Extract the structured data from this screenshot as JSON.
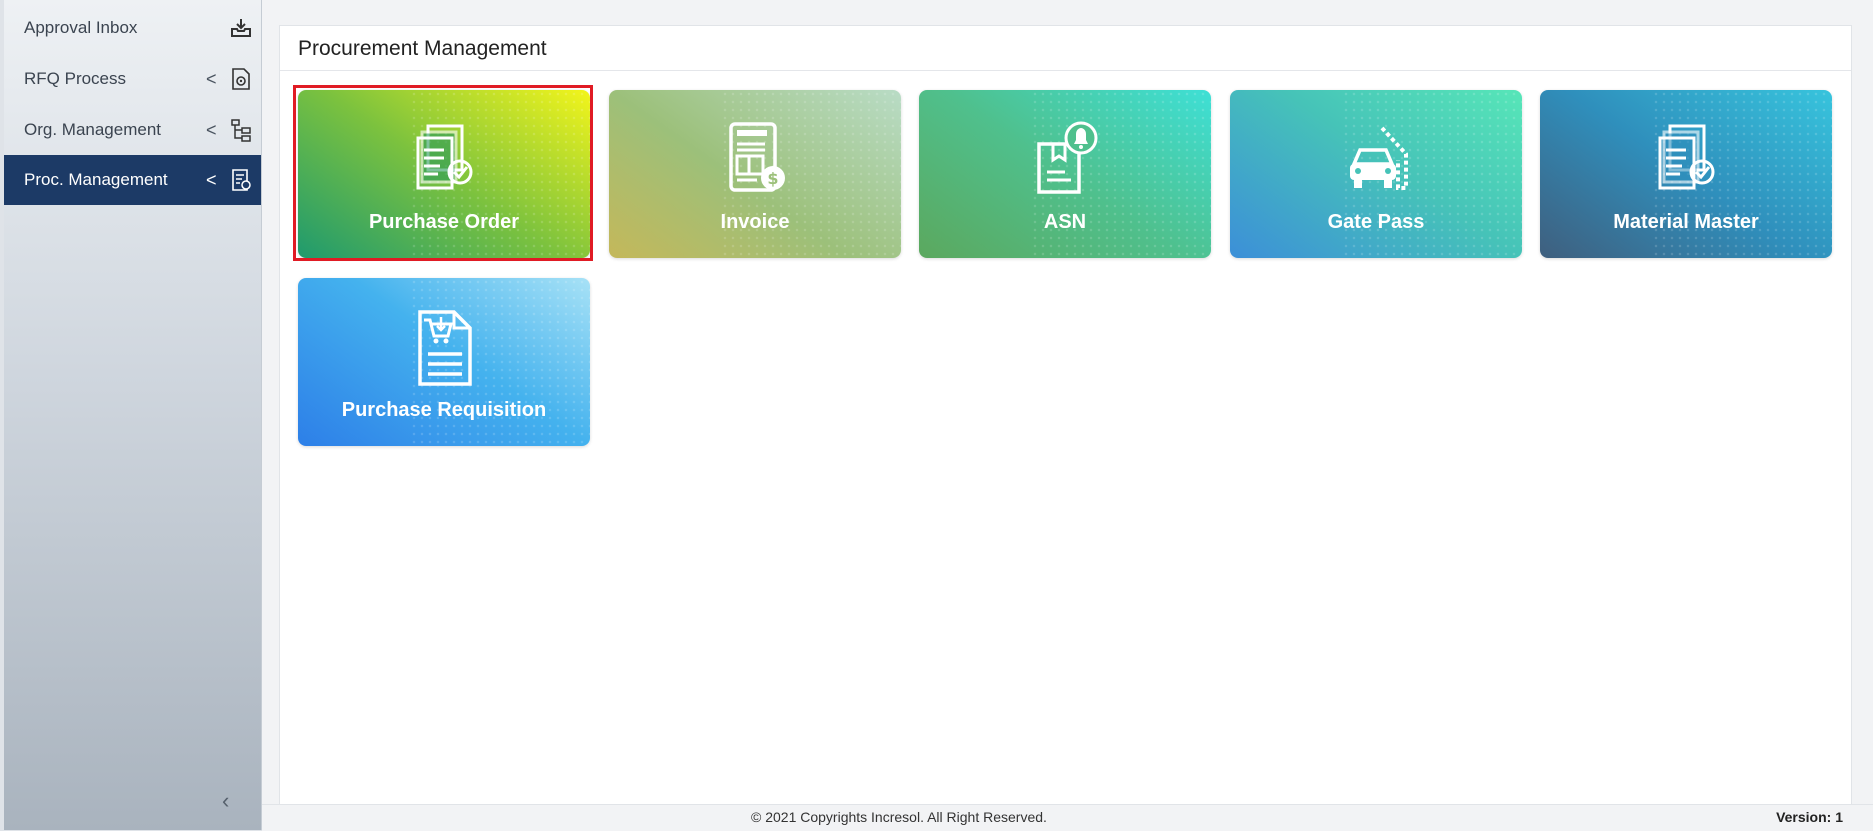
{
  "sidebar": {
    "items": [
      {
        "label": "Approval Inbox",
        "chevron": "",
        "icon": "inbox-download-icon"
      },
      {
        "label": "RFQ Process",
        "chevron": "<",
        "icon": "document-gear-icon"
      },
      {
        "label": "Org. Management",
        "chevron": "<",
        "icon": "org-tree-icon"
      },
      {
        "label": "Proc. Management",
        "chevron": "<",
        "icon": "list-gear-icon"
      }
    ],
    "active_index": 3,
    "collapse_glyph": "‹"
  },
  "main": {
    "title": "Procurement Management",
    "tiles": [
      {
        "label": "Purchase Order",
        "icon": "documents-check-icon",
        "selected": true
      },
      {
        "label": "Invoice",
        "icon": "invoice-dollar-icon"
      },
      {
        "label": "ASN",
        "icon": "box-bell-icon"
      },
      {
        "label": "Gate Pass",
        "icon": "car-gate-icon"
      },
      {
        "label": "Material Master",
        "icon": "documents-check-icon"
      },
      {
        "label": "Purchase Requisition",
        "icon": "document-cart-icon"
      }
    ]
  },
  "footer": {
    "copyright": "© 2021 Copyrights Incresol. All Right Reserved.",
    "version": "Version: 1"
  },
  "colors": {
    "active_sidebar": "#1c3a66",
    "selection_outline": "#e01b24"
  }
}
